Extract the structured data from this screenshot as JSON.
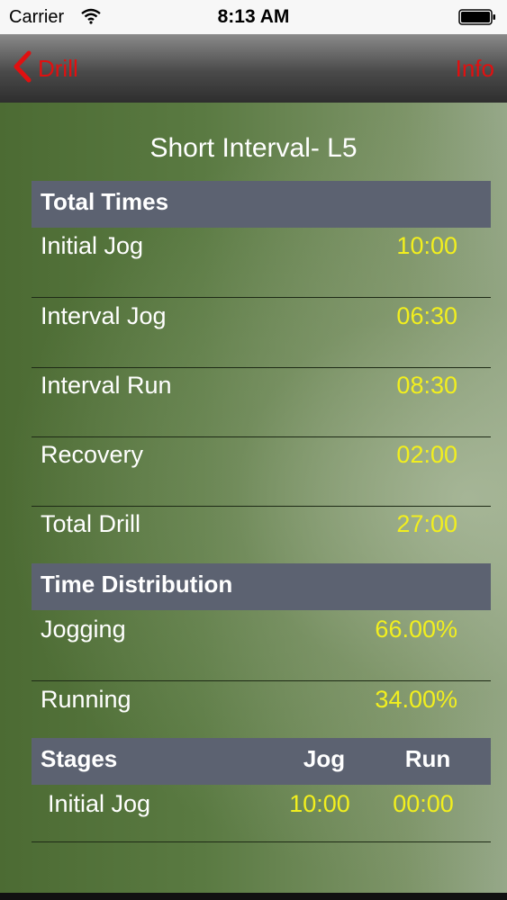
{
  "status": {
    "carrier": "Carrier",
    "time": "8:13 AM"
  },
  "nav": {
    "back_label": "Drill",
    "info_label": "Info"
  },
  "page": {
    "title": "Short Interval- L5"
  },
  "total_times": {
    "header": "Total Times",
    "rows": [
      {
        "label": "Initial Jog",
        "value": "10:00"
      },
      {
        "label": "Interval Jog",
        "value": "06:30"
      },
      {
        "label": "Interval Run",
        "value": "08:30"
      },
      {
        "label": "Recovery",
        "value": "02:00"
      },
      {
        "label": "Total Drill",
        "value": "27:00"
      }
    ]
  },
  "time_distribution": {
    "header": "Time Distribution",
    "rows": [
      {
        "label": "Jogging",
        "value": "66.00%"
      },
      {
        "label": "Running",
        "value": "34.00%"
      }
    ]
  },
  "stages": {
    "header": "Stages",
    "col_jog": "Jog",
    "col_run": "Run",
    "rows": [
      {
        "label": "Initial Jog",
        "jog": "10:00",
        "run": "00:00"
      }
    ]
  },
  "colors": {
    "nav_accent": "#e01010",
    "value_text": "#f2ef1e",
    "header_bg": "#5c6271"
  }
}
